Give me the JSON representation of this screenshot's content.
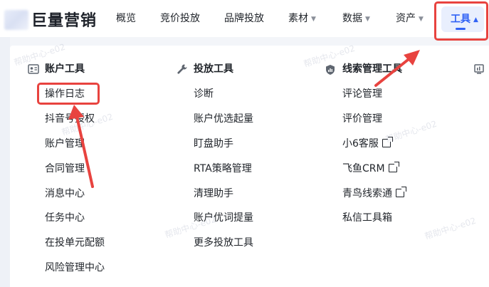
{
  "brand": {
    "name": "巨量营销"
  },
  "nav": {
    "items": [
      {
        "label": "概览",
        "caret": ""
      },
      {
        "label": "竞价投放",
        "caret": ""
      },
      {
        "label": "品牌投放",
        "caret": ""
      },
      {
        "label": "素材",
        "caret": "▼"
      },
      {
        "label": "数据",
        "caret": "▼"
      },
      {
        "label": "资产",
        "caret": "▼"
      }
    ],
    "active": {
      "label": "工具",
      "caret": "▲"
    }
  },
  "menu": {
    "columns": [
      {
        "title": "账户工具",
        "icon": "account-card-icon",
        "items": [
          "操作日志",
          "抖音号授权",
          "账户管理",
          "合同管理",
          "消息中心",
          "任务中心",
          "在投单元配额",
          "风险管理中心"
        ]
      },
      {
        "title": "投放工具",
        "icon": "wrench-icon",
        "items": [
          "诊断",
          "账户优选起量",
          "盯盘助手",
          "RTA策略管理",
          "清理助手",
          "账户优词提量",
          "更多投放工具"
        ]
      },
      {
        "title": "线索管理工具",
        "icon": "lead-shield-icon",
        "items": [
          {
            "label": "评论管理",
            "external": false
          },
          {
            "label": "评价管理",
            "external": false
          },
          {
            "label": "小6客服",
            "external": true
          },
          {
            "label": "飞鱼CRM",
            "external": true
          },
          {
            "label": "青鸟线索通",
            "external": true
          },
          {
            "label": "私信工具箱",
            "external": false
          }
        ]
      }
    ]
  },
  "watermark": "帮助中心-e02",
  "colors": {
    "accent": "#3162f5",
    "highlight": "#e8433f"
  }
}
